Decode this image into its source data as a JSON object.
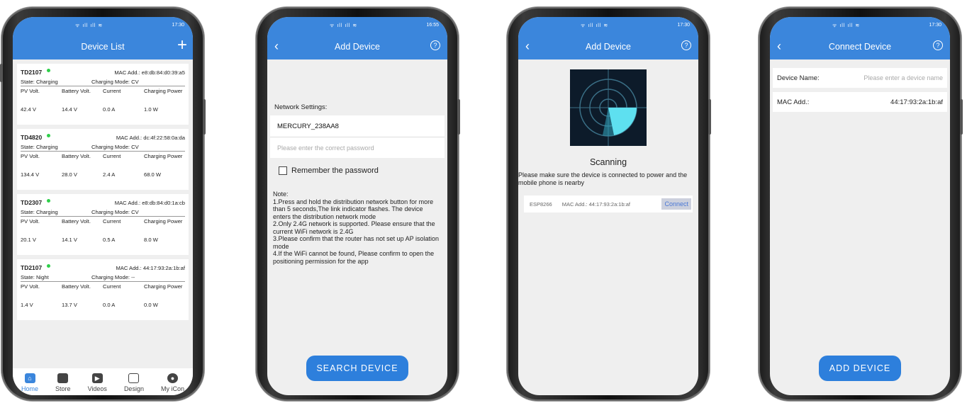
{
  "status": {
    "signal": "ᯤ ıll ıll ≋",
    "time_1": "17:30",
    "time_2": "16:55",
    "time_3": "17:30",
    "time_4": "17:30"
  },
  "screen1": {
    "title": "Device List",
    "add_icon": "+",
    "devices": [
      {
        "name": "TD2107",
        "mac_label": "MAC Add.:",
        "mac": "e8:db:84:d0:39:a5",
        "state": "State:  Charging",
        "mode": "Charging Mode:  CV",
        "h1": "PV Volt.",
        "h2": "Battery Volt.",
        "h3": "Current",
        "h4": "Charging Power",
        "v1": "42.4 V",
        "v2": "14.4 V",
        "v3": "0.0 A",
        "v4": "1.0 W"
      },
      {
        "name": "TD4820",
        "mac_label": "MAC Add.:",
        "mac": "dc:4f:22:58:0a:da",
        "state": "State:  Charging",
        "mode": "Charging Mode:  CV",
        "h1": "PV Volt.",
        "h2": "Battery Volt.",
        "h3": "Current",
        "h4": "Charging Power",
        "v1": "134.4 V",
        "v2": "28.0 V",
        "v3": "2.4 A",
        "v4": "68.0 W"
      },
      {
        "name": "TD2307",
        "mac_label": "MAC Add.:",
        "mac": "e8:db:84:d0:1a:cb",
        "state": "State:  Charging",
        "mode": "Charging Mode:  CV",
        "h1": "PV Volt.",
        "h2": "Battery Volt.",
        "h3": "Current",
        "h4": "Charging Power",
        "v1": "20.1 V",
        "v2": "14.1 V",
        "v3": "0.5 A",
        "v4": "8.0 W"
      },
      {
        "name": "TD2107",
        "mac_label": "MAC Add.:",
        "mac": "44:17:93:2a:1b:af",
        "state": "State:  Night",
        "mode": "Charging Mode:  --",
        "h1": "PV Volt.",
        "h2": "Battery Volt.",
        "h3": "Current",
        "h4": "Charging Power",
        "v1": "1.4 V",
        "v2": "13.7 V",
        "v3": "0.0 A",
        "v4": "0.0 W"
      }
    ],
    "tabs": [
      "Home",
      "Store",
      "Videos",
      "Design",
      "My iCon"
    ]
  },
  "screen2": {
    "title": "Add Device",
    "back_icon": "‹",
    "help_icon": "?",
    "network_label": "Network Settings:",
    "ssid": "MERCURY_238AA8",
    "password_placeholder": "Please enter the correct password",
    "remember": "Remember the password",
    "note": [
      "Note:",
      "1.Press and hold the distribution network button for more than 5 seconds,The link indicator flashes. The device enters the distribution network mode",
      "2.Only 2.4G network is supported. Please ensure that the current WiFi network is 2.4G",
      "3.Please confirm that the router has not set up AP isolation mode",
      "4.If the WiFi cannot be found, Please confirm to open the positioning permission for the app"
    ],
    "button": "SEARCH DEVICE"
  },
  "screen3": {
    "title": "Add Device",
    "scanning": "Scanning",
    "info": "Please make sure the device is connected to power and the mobile phone is nearby",
    "found_name": "ESP8266",
    "found_mac": "MAC Add.:  44:17:93:2a:1b:af",
    "connect": "Connect"
  },
  "screen4": {
    "title": "Connect Device",
    "name_label": "Device Name:",
    "name_placeholder": "Please enter a device name",
    "mac_label": "MAC Add.:",
    "mac": "44:17:93:2a:1b:af",
    "button": "ADD DEVICE"
  },
  "colors": {
    "primary": "#3b86dc",
    "online": "#2fcf4a"
  }
}
